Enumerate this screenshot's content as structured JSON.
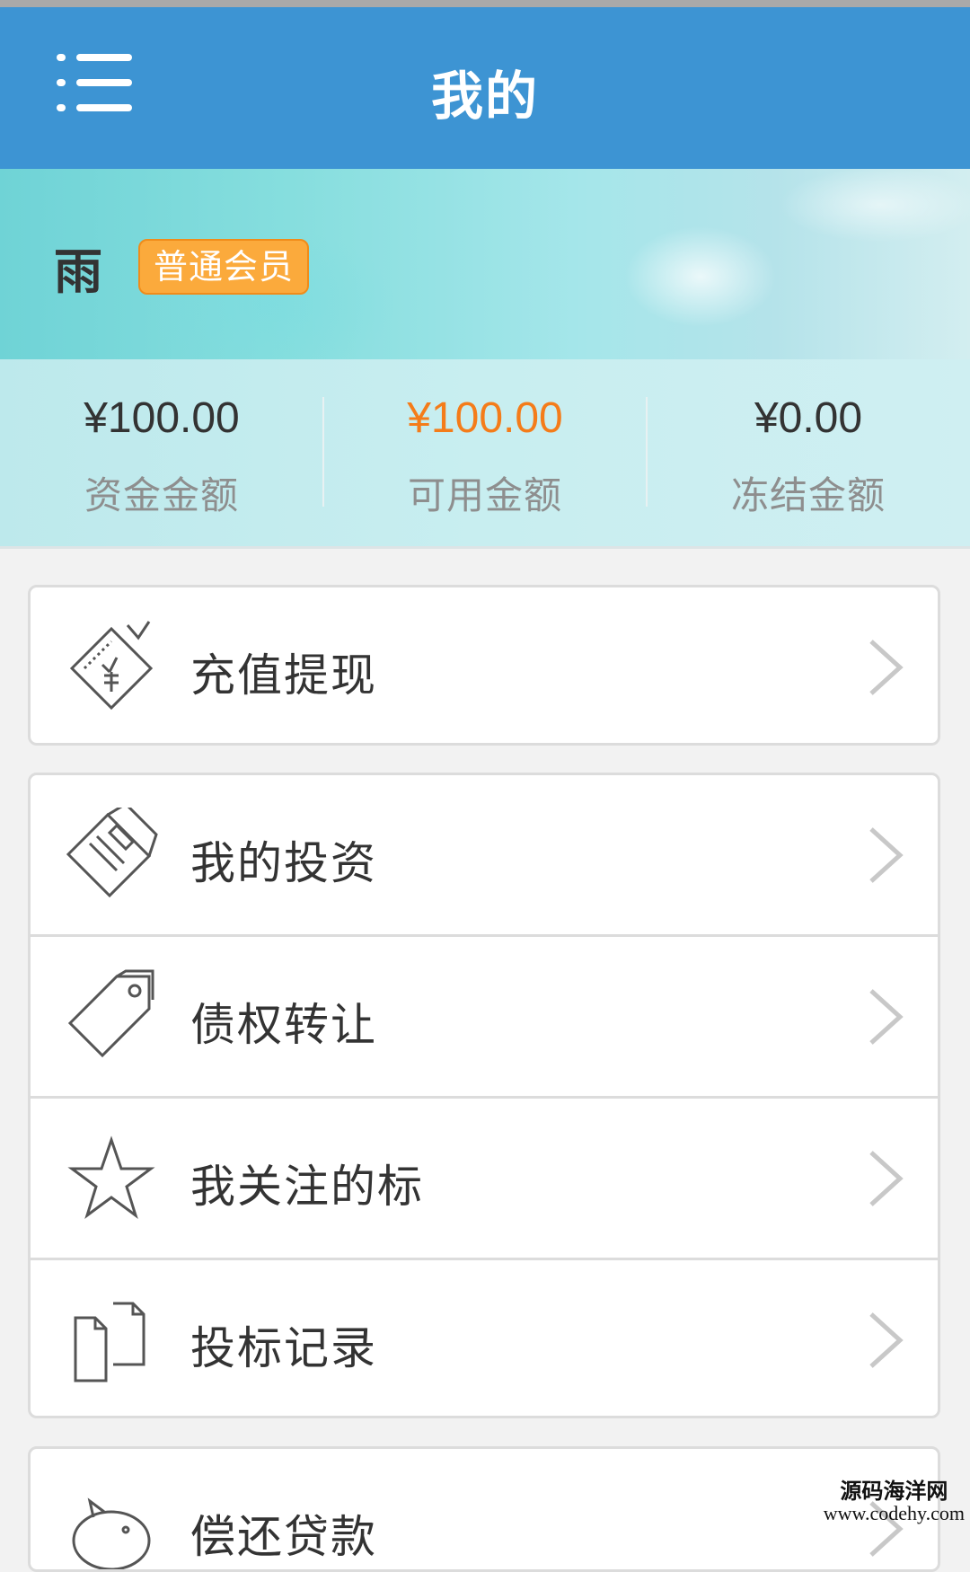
{
  "appbar": {
    "title": "我的",
    "menu_icon": "menu-icon"
  },
  "profile": {
    "username": "雨",
    "member_level": "普通会员"
  },
  "stats": [
    {
      "amount": "¥100.00",
      "label": "资金金额",
      "color": "#333333"
    },
    {
      "amount": "¥100.00",
      "label": "可用金额",
      "color": "#f47c1a"
    },
    {
      "amount": "¥0.00",
      "label": "冻结金额",
      "color": "#333333"
    }
  ],
  "menu": {
    "recharge": {
      "label": "充值提现",
      "icon": "voucher-icon"
    },
    "group2": [
      {
        "label": "我的投资",
        "icon": "cards-icon"
      },
      {
        "label": "债权转让",
        "icon": "tag-icon"
      },
      {
        "label": "我关注的标",
        "icon": "star-icon"
      },
      {
        "label": "投标记录",
        "icon": "documents-icon"
      }
    ],
    "repay": {
      "label": "偿还贷款",
      "icon": "piggy-bank-icon"
    }
  },
  "watermark": {
    "line1": "源码海洋网",
    "line2": "www.codehy.com"
  },
  "colors": {
    "appbar": "#3d94d3",
    "badge": "#fbaa3c",
    "accent_amount": "#f47c1a"
  }
}
